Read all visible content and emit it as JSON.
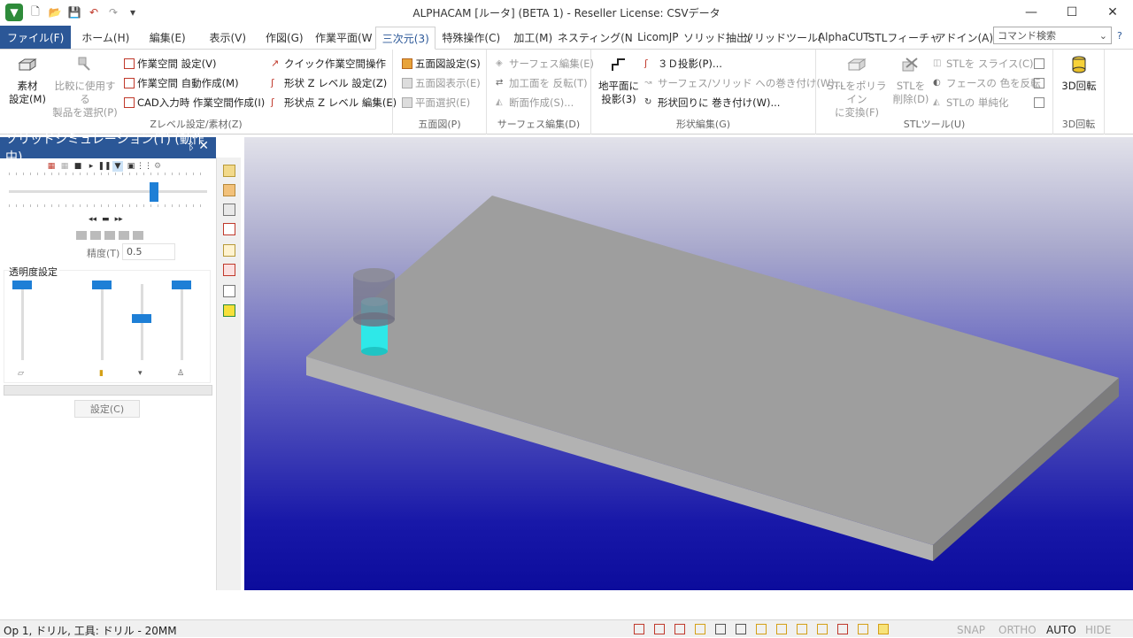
{
  "window": {
    "title": "ALPHACAM [ルータ] (BETA 1)  - Reseller License: CSVデータ",
    "minimize": "—",
    "maximize": "☐",
    "close": "✕"
  },
  "tabs": [
    {
      "label": "ファイル(F)"
    },
    {
      "label": "ホーム(H)"
    },
    {
      "label": "編集(E)"
    },
    {
      "label": "表示(V)"
    },
    {
      "label": "作図(G)"
    },
    {
      "label": "作業平面(W"
    },
    {
      "label": "三次元(3)"
    },
    {
      "label": "特殊操作(C)"
    },
    {
      "label": "加工(M)"
    },
    {
      "label": "ネスティング(N"
    },
    {
      "label": "LicomJP"
    },
    {
      "label": "ソリッド抽出("
    },
    {
      "label": "ソリッドツール("
    },
    {
      "label": "AlphaCUT"
    },
    {
      "label": "STLフィーチャ"
    },
    {
      "label": "アドイン(A)"
    }
  ],
  "command_search": {
    "placeholder": "コマンド検索"
  },
  "ribbon": {
    "groups": {
      "zlevel": "Zレベル設定/素材(Z)",
      "five_face": "五面図(P)",
      "surface": "サーフェス編集(D)",
      "shape": "形状編集(G)",
      "stl": "STLツール(U)",
      "rotate3d": "3D回転"
    },
    "material_line1": "素材",
    "material_line2": "設定(M)",
    "compare_line1": "比較に使用する",
    "compare_line2": "製品を選択(P)",
    "ws_settings": "作業空間 設定(V)",
    "ws_auto": "作業空間 自動作成(M)",
    "ws_cad": "CAD入力時 作業空間作成(I)",
    "quick_ws": "クイック作業空間操作",
    "shape_z": "形状 Z レベル 設定(Z)",
    "shape_point_z": "形状点 Z レベル 編集(E)",
    "five_settings": "五面図設定(S)",
    "five_display": "五面図表示(E)",
    "plane_select": "平面選択(E)",
    "surface_edit": "サーフェス編集(E)",
    "machining_flip": "加工面を 反転(T)",
    "section_create": "断面作成(S)...",
    "ground_line1": "地平面に",
    "ground_line2": "投影(3)",
    "projection_3d": "３Ｄ投影(P)...",
    "wrap_surface": "サーフェス/ソリッド への巻き付け(W)...",
    "wrap_shape": "形状回りに 巻き付け(W)...",
    "stl_poly_line1": "STLをポリライン",
    "stl_poly_line2": "に変換(F)",
    "stl_del_line1": "STLを",
    "stl_del_line2": "削除(D)",
    "stl_slice": "STLを スライス(C)",
    "face_color": "フェースの 色を反転",
    "stl_simplify": "STLの 単純化",
    "rotate3d_btn": "3D回転"
  },
  "panel": {
    "title": "ソリッドシミュレーション(T) (動作中)",
    "pin": "ᛒ",
    "close": "✕",
    "precision_label": "精度(T)",
    "precision_value": "0.5",
    "transparency_label": "透明度設定",
    "settings_button": "設定(C)",
    "playback_position": 0.73,
    "transparency_levels": [
      1.0,
      1.0,
      0.5,
      1.0
    ]
  },
  "status": {
    "text": "Op 1, ドリル, 工具: ドリル - 20MM",
    "snap": "SNAP",
    "ortho": "ORTHO",
    "auto": "AUTO",
    "hide": "HIDE"
  },
  "colors": {
    "accent": "#2b5797",
    "slider": "#1e7fd6",
    "tool_cyan": "#2ee8e8",
    "stock_gray": "#9e9e9e"
  }
}
